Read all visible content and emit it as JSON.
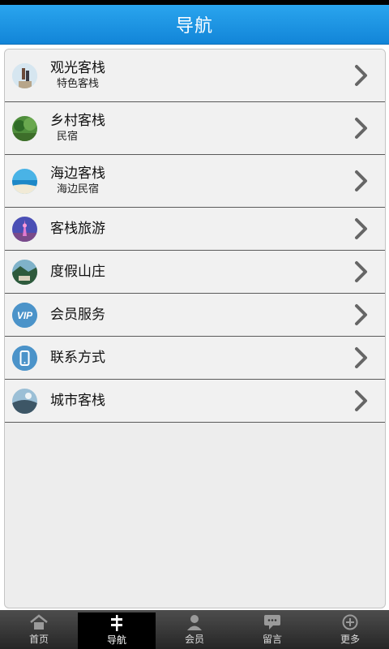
{
  "header": {
    "title": "导航"
  },
  "nav": {
    "items": [
      {
        "title": "观光客栈",
        "subtitle": "特色客栈",
        "icon": "sightseeing-photo-icon"
      },
      {
        "title": "乡村客栈",
        "subtitle": "民宿",
        "icon": "countryside-photo-icon"
      },
      {
        "title": "海边客栈",
        "subtitle": "海边民宿",
        "icon": "beach-photo-icon"
      },
      {
        "title": "客栈旅游",
        "subtitle": "",
        "icon": "tower-photo-icon"
      },
      {
        "title": "度假山庄",
        "subtitle": "",
        "icon": "resort-photo-icon"
      },
      {
        "title": "会员服务",
        "subtitle": "",
        "icon": "vip-icon"
      },
      {
        "title": "联系方式",
        "subtitle": "",
        "icon": "phone-icon"
      },
      {
        "title": "城市客栈",
        "subtitle": "",
        "icon": "city-photo-icon"
      }
    ]
  },
  "tabbar": {
    "tabs": [
      {
        "label": "首页",
        "icon": "home-icon"
      },
      {
        "label": "导航",
        "icon": "signpost-icon",
        "active": true
      },
      {
        "label": "会员",
        "icon": "member-icon"
      },
      {
        "label": "留言",
        "icon": "message-icon"
      },
      {
        "label": "更多",
        "icon": "more-icon"
      }
    ]
  },
  "colors": {
    "header": "#1a93e2",
    "tabbar": "#333333",
    "active_tab": "#000000"
  }
}
